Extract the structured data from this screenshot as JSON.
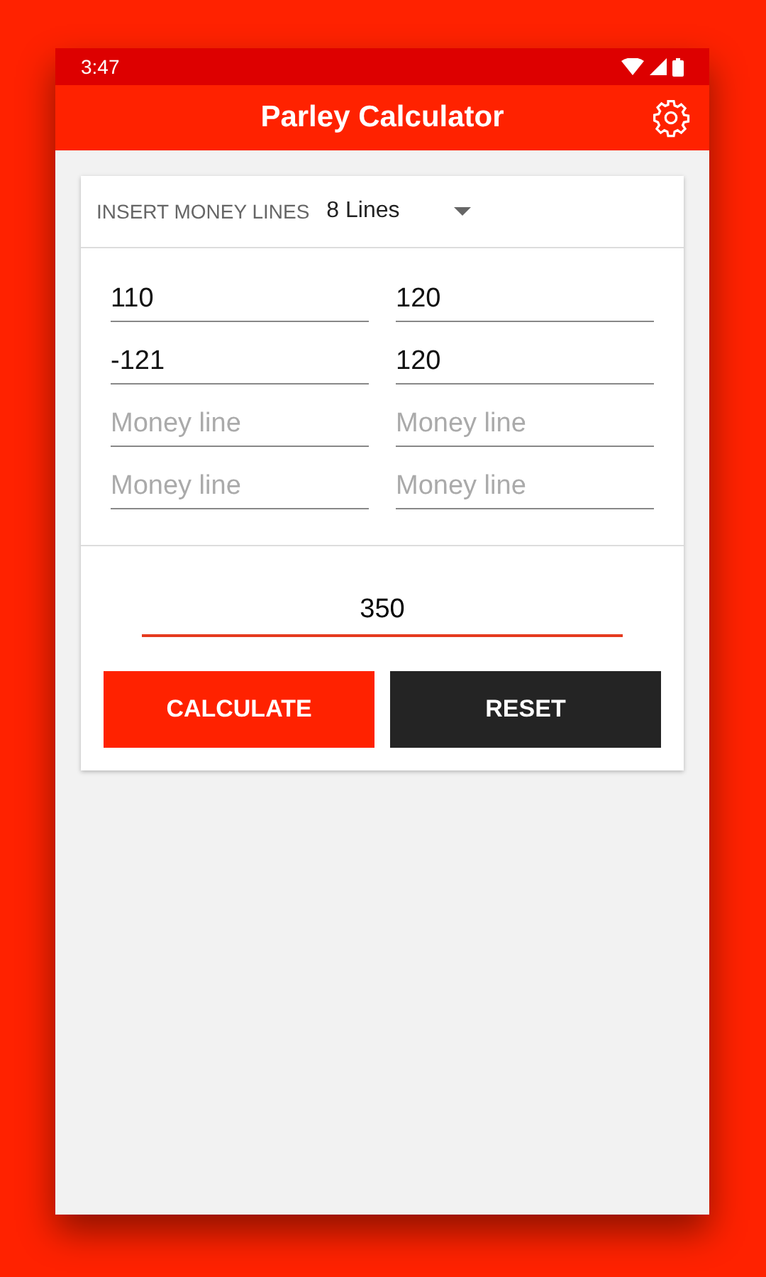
{
  "status_bar": {
    "time": "3:47"
  },
  "app_bar": {
    "title": "Parley Calculator"
  },
  "selector": {
    "label": "INSERT MONEY LINES",
    "value": "8 Lines"
  },
  "money_lines": [
    {
      "value": "110"
    },
    {
      "value": "120"
    },
    {
      "value": "-121"
    },
    {
      "value": "120"
    },
    {
      "placeholder": "Money line"
    },
    {
      "placeholder": "Money line"
    },
    {
      "placeholder": "Money line"
    },
    {
      "placeholder": "Money line"
    }
  ],
  "stake": {
    "value": "350"
  },
  "buttons": [
    {
      "label": "CALCULATE",
      "kind": "primary"
    },
    {
      "label": "RESET",
      "kind": "dark"
    }
  ]
}
